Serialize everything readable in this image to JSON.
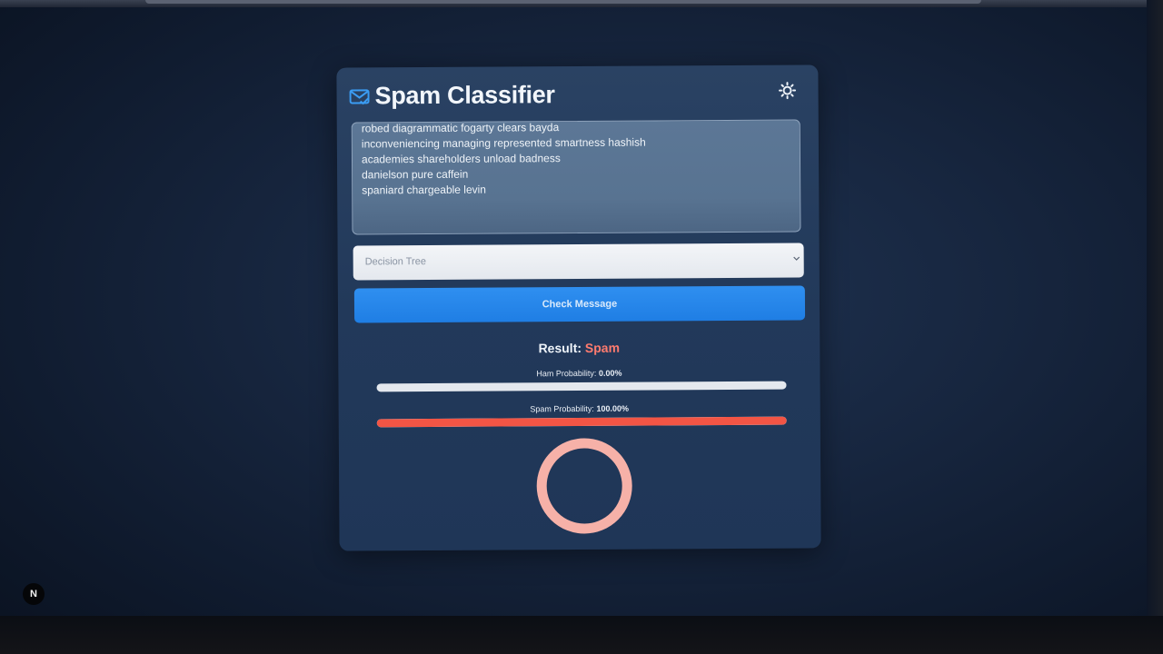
{
  "app": {
    "title": "Spam Classifier",
    "icon": "mail-check-icon",
    "theme_toggle_icon": "sun-icon"
  },
  "message": {
    "lines": [
      "robed diagrammatic fogarty clears bayda",
      "inconveniencing managing represented smartness hashish",
      "academies shareholders unload badness",
      "danielson pure caffein",
      "spaniard chargeable levin"
    ]
  },
  "model_select": {
    "selected": "Decision Tree"
  },
  "check_button": {
    "label": "Check Message"
  },
  "result": {
    "label": "Result:",
    "value": "Spam"
  },
  "probabilities": {
    "ham": {
      "label": "Ham Probability:",
      "value": "0.00%",
      "fraction": 0.0
    },
    "spam": {
      "label": "Spam Probability:",
      "value": "100.00%",
      "fraction": 1.0
    }
  },
  "chart_data": {
    "type": "pie",
    "categories": [
      "Ham",
      "Spam"
    ],
    "values": [
      0.0,
      100.0
    ]
  },
  "colors": {
    "accent": "#2f8ff0",
    "spam": "#f25545",
    "spam_text": "#ff7b6f",
    "donut_spam": "#f6b1a8",
    "ham": "#7fb1e8"
  },
  "dev_badge": {
    "label": "N"
  }
}
